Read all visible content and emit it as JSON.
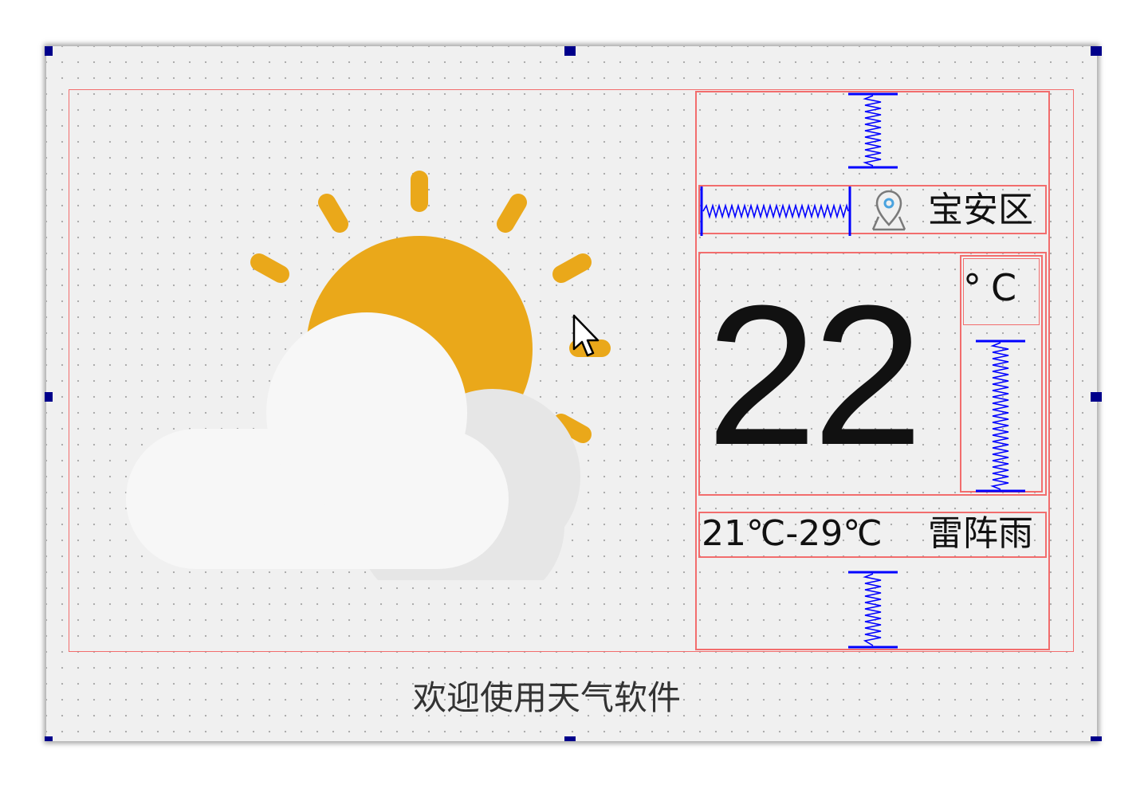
{
  "location": {
    "icon": "location-pin-icon",
    "name": "宝安区"
  },
  "weather": {
    "icon": "partly-cloudy-icon",
    "temperature": "22",
    "unit": "°C",
    "range": "21℃-29℃",
    "condition": "雷阵雨"
  },
  "footer": {
    "welcome": "欢迎使用天气软件"
  },
  "colors": {
    "layout_border": "#f26d6d",
    "spacer": "#0000ff",
    "handle": "#00008b",
    "sun": "#eaa81a",
    "cloud": "#f7f7f7",
    "cloud_shadow": "#e6e6e6"
  }
}
